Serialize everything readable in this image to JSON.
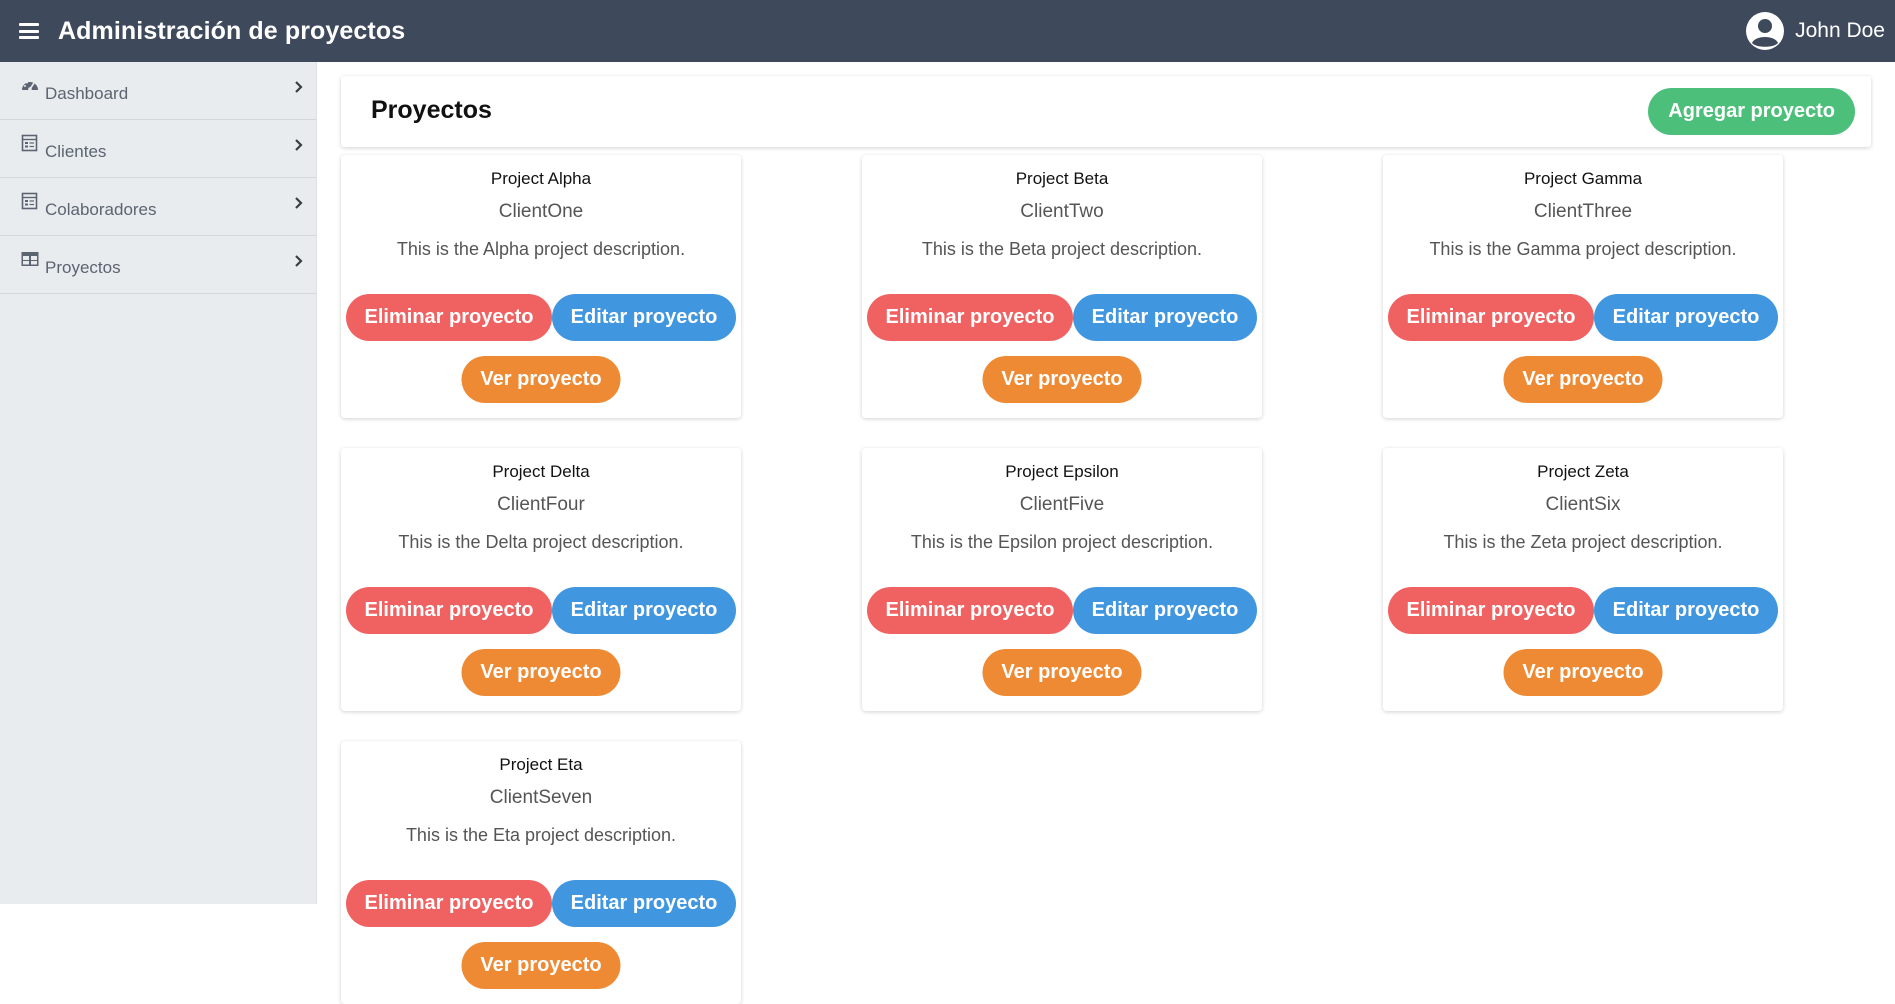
{
  "header": {
    "title": "Administración de proyectos",
    "user_name": "John Doe"
  },
  "sidebar": {
    "items": [
      {
        "label": "Dashboard",
        "icon": "dashboard-icon"
      },
      {
        "label": "Clientes",
        "icon": "clients-icon"
      },
      {
        "label": "Colaboradores",
        "icon": "collaborators-icon"
      },
      {
        "label": "Proyectos",
        "icon": "projects-table-icon"
      }
    ]
  },
  "main": {
    "title": "Proyectos",
    "add_label": "Agregar proyecto",
    "delete_label": "Eliminar proyecto",
    "edit_label": "Editar proyecto",
    "view_label": "Ver proyecto",
    "projects": [
      {
        "name": "Project Alpha",
        "client": "ClientOne",
        "description": "This is the Alpha project description."
      },
      {
        "name": "Project Beta",
        "client": "ClientTwo",
        "description": "This is the Beta project description."
      },
      {
        "name": "Project Gamma",
        "client": "ClientThree",
        "description": "This is the Gamma project description."
      },
      {
        "name": "Project Delta",
        "client": "ClientFour",
        "description": "This is the Delta project description."
      },
      {
        "name": "Project Epsilon",
        "client": "ClientFive",
        "description": "This is the Epsilon project description."
      },
      {
        "name": "Project Zeta",
        "client": "ClientSix",
        "description": "This is the Zeta project description."
      },
      {
        "name": "Project Eta",
        "client": "ClientSeven",
        "description": "This is the Eta project description."
      }
    ]
  },
  "colors": {
    "topbar": "#3e495c",
    "sidebar": "#e9ecef",
    "add_button": "#4cc07a",
    "delete_button": "#f06262",
    "edit_button": "#4196e0",
    "view_button": "#ef8a34"
  }
}
